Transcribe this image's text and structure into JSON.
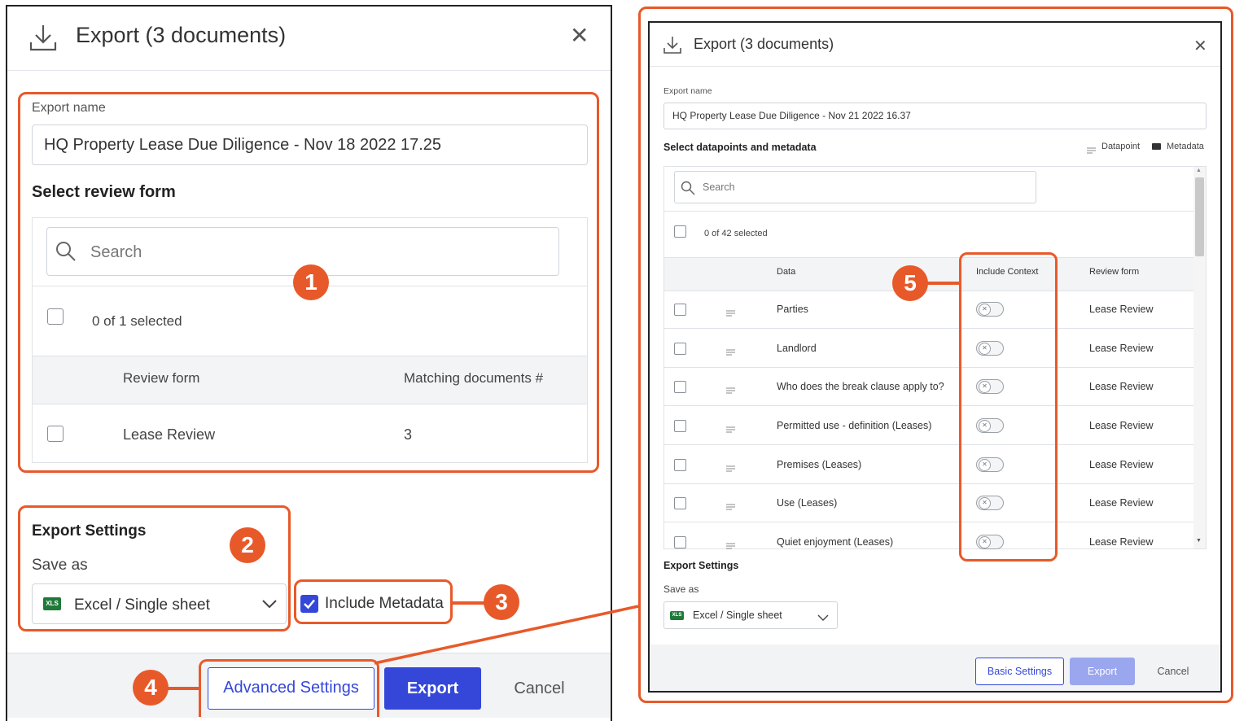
{
  "left_dialog": {
    "title": "Export (3 documents)",
    "export_name_label": "Export name",
    "export_name_value": "HQ Property Lease Due Diligence - Nov 18 2022 17.25",
    "select_review_form": "Select review form",
    "search_placeholder": "Search",
    "selected_count": "0 of 1 selected",
    "columns": [
      "Review form",
      "Matching documents #"
    ],
    "rows": [
      {
        "review_form": "Lease Review",
        "matching": "3"
      }
    ],
    "export_settings": "Export Settings",
    "save_as_label": "Save as",
    "save_as_value": "Excel / Single sheet",
    "include_metadata": "Include Metadata",
    "advanced_settings": "Advanced Settings",
    "export": "Export",
    "cancel": "Cancel"
  },
  "right_dialog": {
    "title": "Export (3 documents)",
    "export_name_label": "Export name",
    "export_name_value": "HQ Property Lease Due Diligence - Nov 21 2022 16.37",
    "select_datapoints": "Select datapoints and metadata",
    "legend_datapoint": "Datapoint",
    "legend_metadata": "Metadata",
    "search_placeholder": "Search",
    "selected_count": "0 of 42 selected",
    "columns": [
      "Data",
      "Include Context",
      "Review form"
    ],
    "rows": [
      {
        "data": "Parties",
        "review_form": "Lease Review",
        "include_context": false
      },
      {
        "data": "Landlord",
        "review_form": "Lease Review",
        "include_context": false
      },
      {
        "data": "Who does the break clause apply to?",
        "review_form": "Lease Review",
        "include_context": false
      },
      {
        "data": "Permitted use - definition (Leases)",
        "review_form": "Lease Review",
        "include_context": false
      },
      {
        "data": "Premises (Leases)",
        "review_form": "Lease Review",
        "include_context": false
      },
      {
        "data": "Use (Leases)",
        "review_form": "Lease Review",
        "include_context": false
      },
      {
        "data": "Quiet enjoyment (Leases)",
        "review_form": "Lease Review",
        "include_context": false
      }
    ],
    "export_settings": "Export Settings",
    "save_as_label": "Save as",
    "save_as_value": "Excel / Single sheet",
    "basic_settings": "Basic Settings",
    "export": "Export",
    "cancel": "Cancel"
  },
  "file_type_badge": "XLS",
  "callouts": [
    "1",
    "2",
    "3",
    "4",
    "5"
  ],
  "colors": {
    "highlight": "#e8592a",
    "primary": "#3447d9",
    "primary_disabled": "#9aa6ee"
  }
}
